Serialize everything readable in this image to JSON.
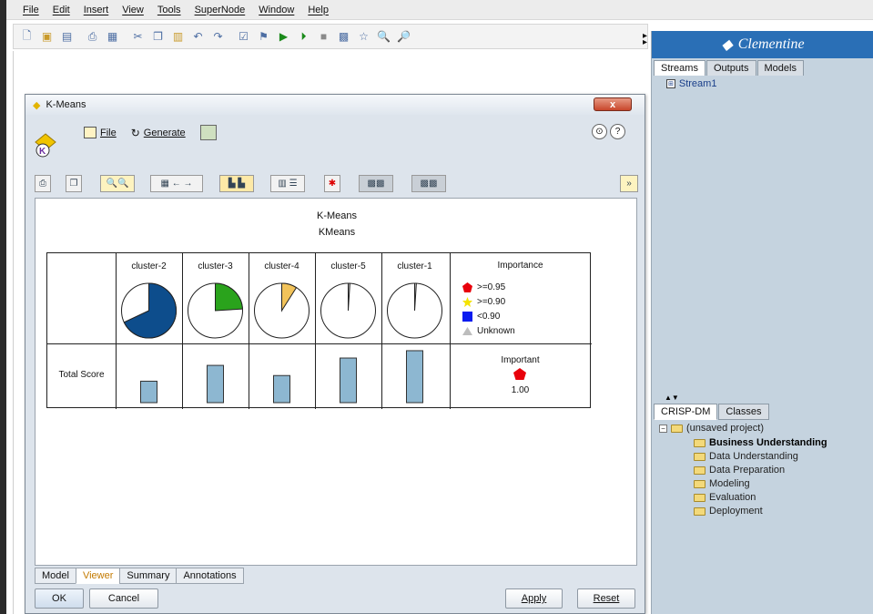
{
  "menubar": {
    "items": [
      "File",
      "Edit",
      "Insert",
      "View",
      "Tools",
      "SuperNode",
      "Window",
      "Help"
    ]
  },
  "toolbar": {
    "icons": [
      "new-file-icon",
      "open-folder-icon",
      "save-icon",
      "print-icon",
      "print-preview-icon",
      "cut-icon",
      "copy-icon",
      "paste-icon",
      "undo-icon",
      "redo-icon",
      "check-icon",
      "execute-selection-icon",
      "run-icon",
      "run-stream-icon",
      "stop-icon",
      "stream-properties-icon",
      "star-icon",
      "zoom-in-icon",
      "zoom-out-icon"
    ]
  },
  "right_panel": {
    "brand": "Clementine",
    "tabs": [
      "Streams",
      "Outputs",
      "Models"
    ],
    "active_tab": "Streams",
    "stream_item": "Stream1",
    "crisp_tabs": [
      "CRISP-DM",
      "Classes"
    ],
    "crisp_active": "CRISP-DM",
    "project_root": "(unsaved project)",
    "phases": [
      "Business Understanding",
      "Data Understanding",
      "Data Preparation",
      "Modeling",
      "Evaluation",
      "Deployment"
    ]
  },
  "dialog": {
    "title": "K-Means",
    "close_label": "x",
    "menu_file": "File",
    "menu_generate": "Generate",
    "help_label": "?",
    "more_label": "»",
    "viewer": {
      "title": "K-Means",
      "subtitle": "KMeans",
      "clusters": [
        "cluster-2",
        "cluster-3",
        "cluster-4",
        "cluster-5",
        "cluster-1"
      ],
      "row_label": "Total Score",
      "legend_title": "Importance",
      "legend": [
        {
          "label": ">=0.95",
          "color": "#e8000b"
        },
        {
          "label": ">=0.90",
          "color": "#f4e300"
        },
        {
          "label": "<0.90",
          "color": "#0a1cf0"
        },
        {
          "label": "Unknown",
          "color": "#bdbdbd"
        }
      ],
      "importance_label": "Important",
      "importance_value": "1.00",
      "pie_fractions": [
        0.68,
        0.24,
        0.09,
        0.01,
        0.01
      ],
      "pie_colors": [
        "#0d4d8c",
        "#2aa31c",
        "#f2c35a",
        "#cccccc",
        "#cccccc"
      ],
      "bar_values": [
        0.38,
        0.66,
        0.48,
        0.79,
        0.92
      ],
      "bar_color": "#8db7d1"
    },
    "bottom_tabs": [
      "Model",
      "Viewer",
      "Summary",
      "Annotations"
    ],
    "active_bottom_tab": "Viewer",
    "buttons": {
      "ok": "OK",
      "cancel": "Cancel",
      "apply": "Apply",
      "reset": "Reset"
    }
  }
}
